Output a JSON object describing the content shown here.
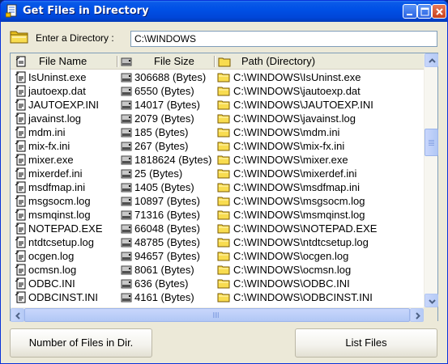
{
  "window": {
    "title": "Get Files in Directory",
    "title_color": "#ffffff",
    "titlebar_color": "#0054e3"
  },
  "directory": {
    "label": "Enter a Directory :",
    "value": "C:\\WINDOWS"
  },
  "list": {
    "columns": [
      {
        "label": "File Name",
        "icon": "file-icon"
      },
      {
        "label": "File Size",
        "icon": "drive-icon"
      },
      {
        "label": "Path (Directory)",
        "icon": "folder-icon"
      }
    ],
    "rows": [
      {
        "name": "IsUninst.exe",
        "size": "306688 (Bytes)",
        "path": "C:\\WINDOWS\\IsUninst.exe"
      },
      {
        "name": "jautoexp.dat",
        "size": "6550 (Bytes)",
        "path": "C:\\WINDOWS\\jautoexp.dat"
      },
      {
        "name": "JAUTOEXP.INI",
        "size": "14017 (Bytes)",
        "path": "C:\\WINDOWS\\JAUTOEXP.INI"
      },
      {
        "name": "javainst.log",
        "size": "2079 (Bytes)",
        "path": "C:\\WINDOWS\\javainst.log"
      },
      {
        "name": "mdm.ini",
        "size": "185 (Bytes)",
        "path": "C:\\WINDOWS\\mdm.ini"
      },
      {
        "name": "mix-fx.ini",
        "size": "267 (Bytes)",
        "path": "C:\\WINDOWS\\mix-fx.ini"
      },
      {
        "name": "mixer.exe",
        "size": "1818624 (Bytes)",
        "path": "C:\\WINDOWS\\mixer.exe"
      },
      {
        "name": "mixerdef.ini",
        "size": "25 (Bytes)",
        "path": "C:\\WINDOWS\\mixerdef.ini"
      },
      {
        "name": "msdfmap.ini",
        "size": "1405 (Bytes)",
        "path": "C:\\WINDOWS\\msdfmap.ini"
      },
      {
        "name": "msgsocm.log",
        "size": "10897 (Bytes)",
        "path": "C:\\WINDOWS\\msgsocm.log"
      },
      {
        "name": "msmqinst.log",
        "size": "71316 (Bytes)",
        "path": "C:\\WINDOWS\\msmqinst.log"
      },
      {
        "name": "NOTEPAD.EXE",
        "size": "66048 (Bytes)",
        "path": "C:\\WINDOWS\\NOTEPAD.EXE"
      },
      {
        "name": "ntdtcsetup.log",
        "size": "48785 (Bytes)",
        "path": "C:\\WINDOWS\\ntdtcsetup.log"
      },
      {
        "name": "ocgen.log",
        "size": "94657 (Bytes)",
        "path": "C:\\WINDOWS\\ocgen.log"
      },
      {
        "name": "ocmsn.log",
        "size": "8061 (Bytes)",
        "path": "C:\\WINDOWS\\ocmsn.log"
      },
      {
        "name": "ODBC.INI",
        "size": "636 (Bytes)",
        "path": "C:\\WINDOWS\\ODBC.INI"
      },
      {
        "name": "ODBCINST.INI",
        "size": "4161 (Bytes)",
        "path": "C:\\WINDOWS\\ODBCINST.INI"
      }
    ],
    "vertical_scroll_position": 0.31
  },
  "buttons": {
    "count_label": "Number of Files in Dir.",
    "list_label": "List Files"
  }
}
